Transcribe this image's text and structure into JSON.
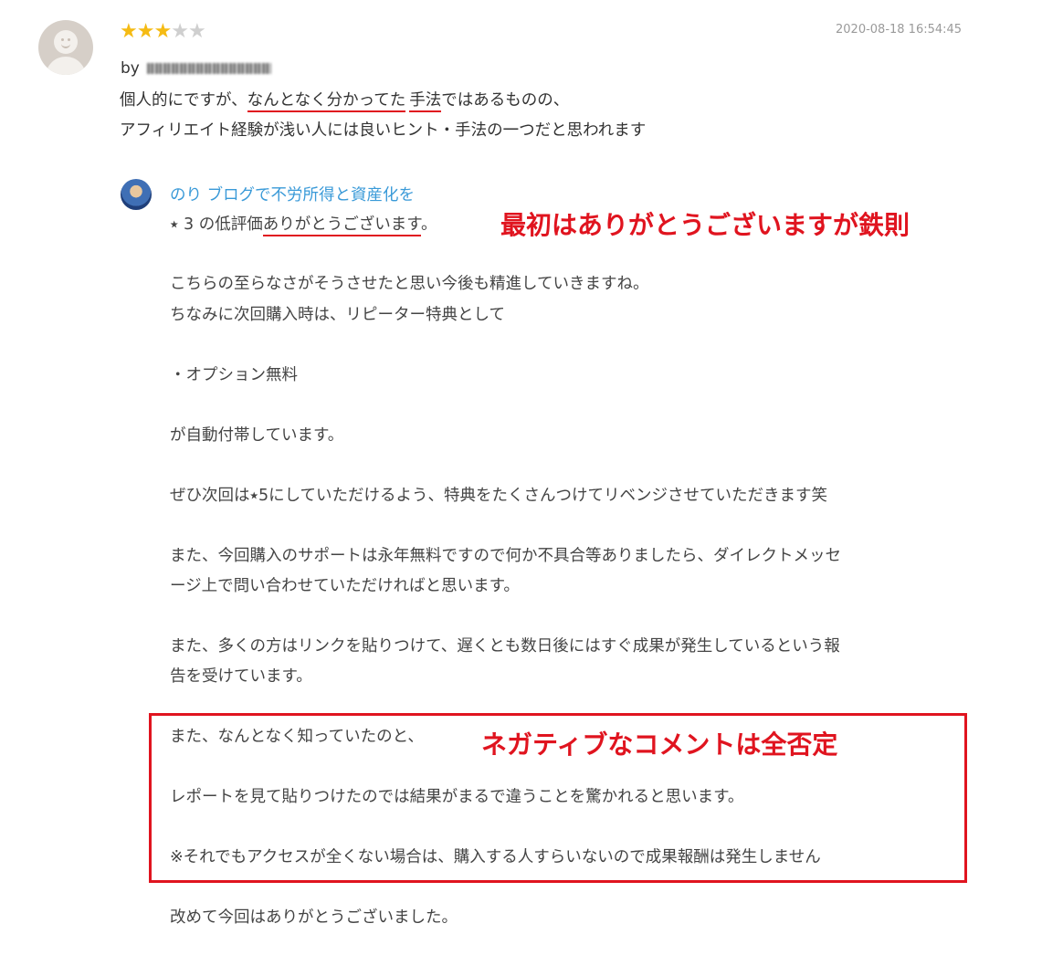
{
  "review": {
    "rating": 3,
    "max_rating": 5,
    "timestamp": "2020-08-18 16:54:45",
    "by_label": "by",
    "line1": {
      "pre": "個人的にですが、",
      "u1": "なんとなく分かってた",
      "u2": "手法",
      "post": "ではあるものの、"
    },
    "line2": "アフィリエイト経験が浅い人には良いヒント・手法の一つだと思われます"
  },
  "reply": {
    "seller_name": "のり ブログで不労所得と資産化を",
    "thanks": {
      "pre": "⭑ 3 の低評価",
      "underlined": "ありがとうございます",
      "post": "。"
    },
    "paragraphs": [
      "こちらの至らなさがそうさせたと思い今後も精進していきますね。",
      "ちなみに次回購入時は、リピーター特典として",
      "・オプション無料",
      "が自動付帯しています。",
      "ぜひ次回は⭑5にしていただけるよう、特典をたくさんつけてリベンジさせていただきます笑",
      "また、今回購入のサポートは永年無料ですので何か不具合等ありましたら、ダイレクトメッセ",
      "ージ上で問い合わせていただければと思います。",
      "また、多くの方はリンクを貼りつけて、遅くとも数日後にはすぐ成果が発生しているという報",
      "告を受けています。",
      "また、なんとなく知っていたのと、",
      "レポートを見て貼りつけたのでは結果がまるで違うことを驚かれると思います。",
      "※それでもアクセスが全くない場合は、購入する人すらいないので成果報酬は発生しません",
      "改めて今回はありがとうございました。"
    ]
  },
  "annotations": {
    "first": "最初はありがとうございますが鉄則",
    "second": "ネガティブなコメントは全否定"
  },
  "colors": {
    "accent_red": "#e0141f",
    "star": "#f5bb14",
    "seller_link": "#3a9ad8"
  }
}
